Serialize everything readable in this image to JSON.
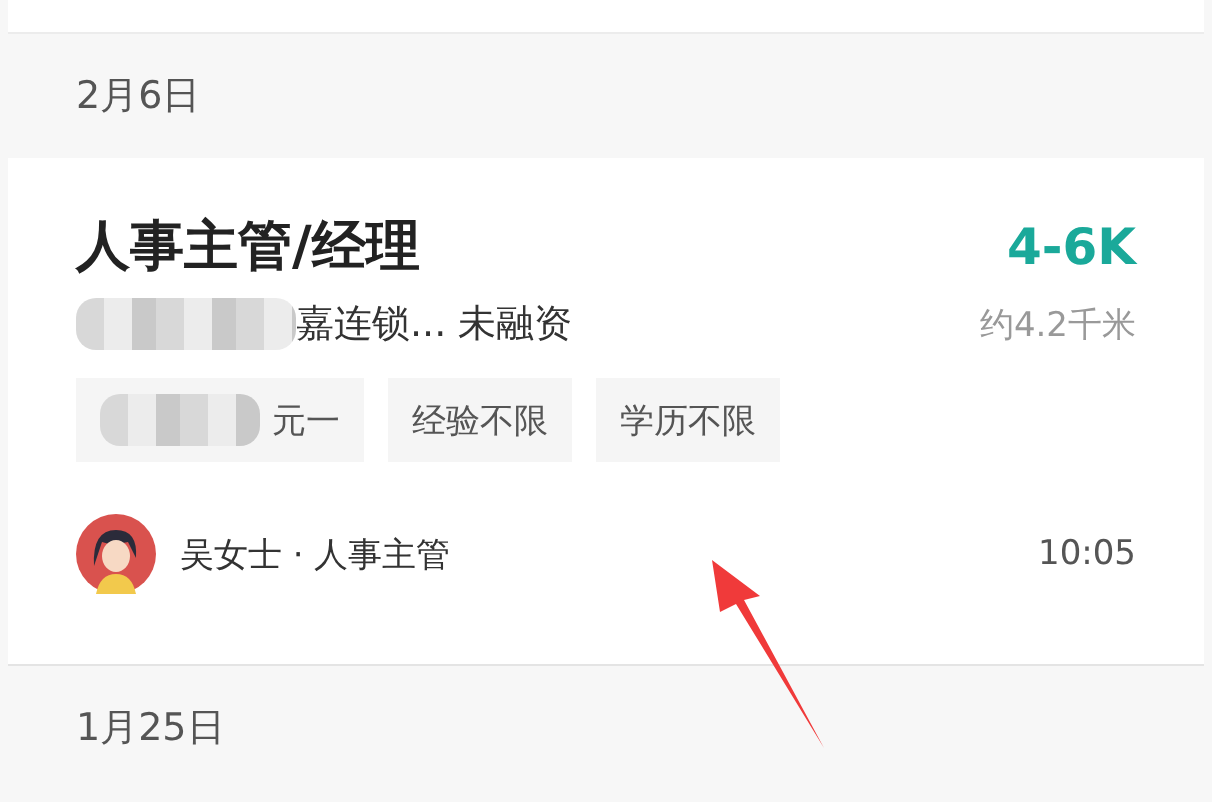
{
  "sections": [
    {
      "date": "2月6日",
      "jobs": [
        {
          "title": "人事主管/经理",
          "salary": "4-6K",
          "company": "嘉连锁... 未融资",
          "company_redacted": true,
          "distance": "约4.2千米",
          "tags": [
            {
              "text": "元一",
              "redacted": true
            },
            {
              "text": "经验不限",
              "redacted": false
            },
            {
              "text": "学历不限",
              "redacted": false
            }
          ],
          "recruiter": "吴女士 · 人事主管",
          "time": "10:05"
        }
      ]
    },
    {
      "date": "1月25日"
    }
  ],
  "annotation": {
    "kind": "arrow"
  }
}
